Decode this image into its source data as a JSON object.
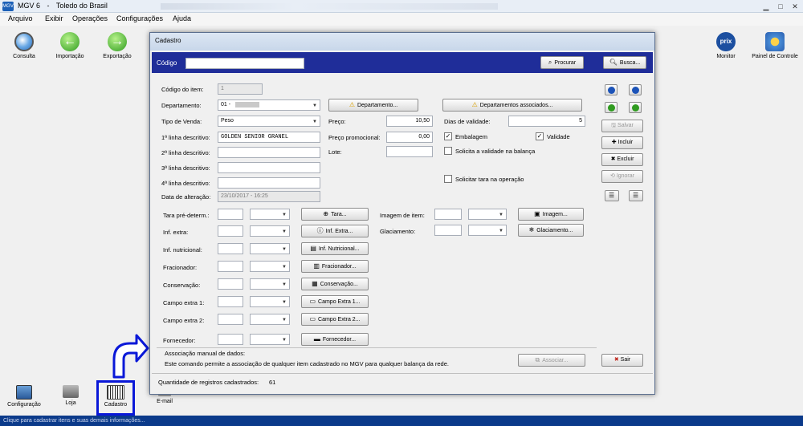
{
  "window": {
    "title_app": "MGV 6",
    "title_sep": "-",
    "title_company": "Toledo do Brasil",
    "icon_label": "MGV"
  },
  "menu": [
    "Arquivo",
    "Exibir",
    "Operações",
    "Configurações",
    "Ajuda"
  ],
  "toolbar": {
    "left": [
      {
        "label": "Consulta",
        "icon": "magnifier-icon"
      },
      {
        "label": "Importação",
        "icon": "green-arrow-left-icon"
      },
      {
        "label": "Exportação",
        "icon": "green-arrow-right-icon"
      }
    ],
    "right": [
      {
        "label": "Monitor",
        "icon": "prix-icon",
        "icon_text": "prix"
      },
      {
        "label": "Painel de Controle",
        "icon": "gear-icon"
      }
    ]
  },
  "bottom": {
    "items": [
      {
        "label": "Configuração",
        "icon": "computer-icon"
      },
      {
        "label": "Loja",
        "icon": "store-icon"
      },
      {
        "label": "Cadastro",
        "icon": "barcode-icon"
      },
      {
        "label": "E-mail",
        "icon": "email-icon"
      }
    ],
    "status": "Clique para cadastrar itens e suas demais informações..."
  },
  "dialog": {
    "title": "Cadastro",
    "code_label": "Código",
    "code_value": "",
    "btn_procurar": "Procurar",
    "btn_busca": "Busca...",
    "fields": {
      "codigo_item_label": "Código do item:",
      "codigo_item_value": "1",
      "departamento_label": "Departamento:",
      "departamento_value": "01 -",
      "tipo_venda_label": "Tipo de Venda:",
      "tipo_venda_value": "Peso",
      "linha1_label": "1ª linha descritivo:",
      "linha1_value": "GOLDEN SENIOR GRANEL",
      "linha2_label": "2ª linha descritivo:",
      "linha3_label": "3ª linha descritivo:",
      "linha4_label": "4ª linha descritivo:",
      "data_alt_label": "Data de alteração:",
      "data_alt_value": "23/10/2017 - 16:25",
      "preco_label": "Preço:",
      "preco_value": "10,50",
      "preco_promo_label": "Preço promocional:",
      "preco_promo_value": "0,00",
      "lote_label": "Lote:",
      "dias_validade_label": "Dias de validade:",
      "dias_validade_value": "5",
      "embalagem_label": "Embalagem",
      "validade_label": "Validade",
      "solicita_validade_label": "Solicita a validade na balança",
      "solicitar_tara_label": "Solicitar tara na operação",
      "btn_departamento": "Departamento...",
      "btn_departamentos_assoc": "Departamentos associados..."
    },
    "lower_rows": [
      {
        "label": "Tara pré-determ.:",
        "button": "Tara..."
      },
      {
        "label": "Inf. extra:",
        "button": "Inf. Extra..."
      },
      {
        "label": "Inf. nutricional:",
        "button": "Inf. Nutricional..."
      },
      {
        "label": "Fracionador:",
        "button": "Fracionador..."
      },
      {
        "label": "Conservação:",
        "button": "Conservação..."
      },
      {
        "label": "Campo extra 1:",
        "button": "Campo Extra 1..."
      },
      {
        "label": "Campo extra 2:",
        "button": "Campo Extra 2..."
      },
      {
        "label": "Fornecedor:",
        "button": "Fornecedor..."
      }
    ],
    "right_rows": [
      {
        "label": "Imagem de item:",
        "button": "Imagem..."
      },
      {
        "label": "Glaciamento:",
        "button": "Glaciamento..."
      }
    ],
    "side_buttons": {
      "salvar": "Salvar",
      "incluir": "Incluir",
      "excluir": "Excluir",
      "ignorar": "Ignorar"
    },
    "assoc": {
      "title": "Associação manual de dados:",
      "desc": "Este comando permite a associação de qualquer item cadastrado no MGV para qualquer balança da rede.",
      "btn": "Associar...",
      "btn_sair": "Sair"
    },
    "qtd_label": "Quantidade de registros cadastrados:",
    "qtd_value": "61"
  },
  "colors": {
    "dialog_header_blue": "#1f2d99",
    "status_blue": "#0b3a8a",
    "highlight_blue": "#0a18d8"
  }
}
